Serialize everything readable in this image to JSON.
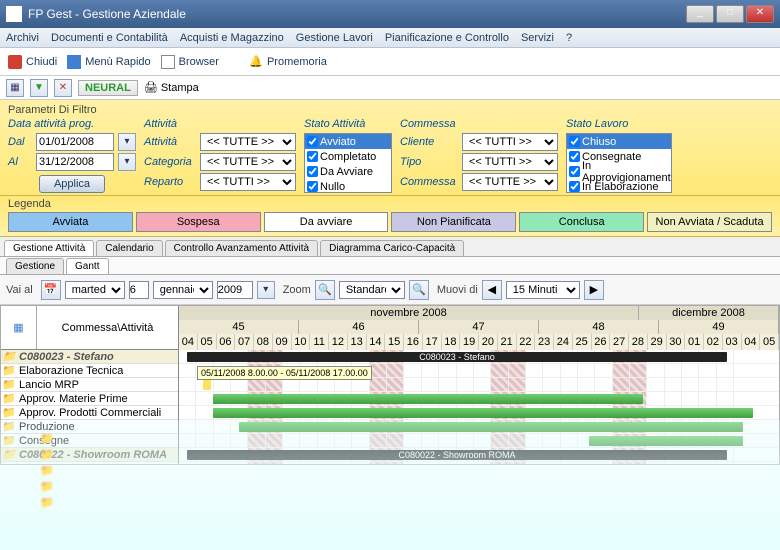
{
  "window": {
    "title": "FP Gest - Gestione Aziendale"
  },
  "menubar": [
    "Archivi",
    "Documenti e Contabilità",
    "Acquisti e Magazzino",
    "Gestione Lavori",
    "Pianificazione e Controllo",
    "Servizi",
    "?"
  ],
  "toolbar1": {
    "chiudi": "Chiudi",
    "menurapido": "Menù Rapido",
    "browser": "Browser",
    "promemoria": "Promemoria"
  },
  "toolbar2": {
    "neural": "NEURAL",
    "stampa": "Stampa"
  },
  "filter": {
    "title": "Parametri Di Filtro",
    "dateheader": "Data attività prog.",
    "dal_lbl": "Dal",
    "dal": "01/01/2008",
    "al_lbl": "Al",
    "al": "31/12/2008",
    "applica": "Applica",
    "attivita_hdr": "Attività",
    "attivita_lbl": "Attività",
    "attivita_val": "<< TUTTE >>",
    "categoria_lbl": "Categoria",
    "categoria_val": "<< TUTTE >>",
    "reparto_lbl": "Reparto",
    "reparto_val": "<< TUTTI >>",
    "stato_hdr": "Stato Attività",
    "stato_items": [
      "Avviato",
      "Completato",
      "Da Avviare",
      "Nullo"
    ],
    "commessa_hdr": "Commessa",
    "cliente_lbl": "Cliente",
    "cliente_val": "<< TUTTI >>",
    "tipo_lbl": "Tipo",
    "tipo_val": "<< TUTTI >>",
    "commessa_lbl": "Commessa",
    "commessa_val": "<< TUTTE >>",
    "statolavoro_hdr": "Stato Lavoro",
    "statolavoro_items": [
      "Chiuso",
      "Consegnate",
      "In Approvigionamento",
      "In Elaborazione"
    ]
  },
  "legend": {
    "title": "Legenda",
    "items": [
      {
        "label": "Avviata",
        "bg": "#8fc4f0"
      },
      {
        "label": "Sospesa",
        "bg": "#f4a8b8"
      },
      {
        "label": "Da avviare",
        "bg": "#ffffff"
      },
      {
        "label": "Non Pianificata",
        "bg": "#c8c8e4"
      },
      {
        "label": "Conclusa",
        "bg": "#90e8b8"
      },
      {
        "label": "Non Avviata / Scaduta",
        "bg": "#f0f0c0"
      }
    ]
  },
  "tabs": [
    "Gestione Attività",
    "Calendario",
    "Controllo Avanzamento Attività",
    "Diagramma Carico-Capacità"
  ],
  "subtabs": [
    "Gestione",
    "Gantt"
  ],
  "gantt": {
    "vaiall": "Vai al",
    "zoom": "Zoom",
    "muovidi": "Muovi di",
    "date_day": "martedì",
    "date_num": "6",
    "date_month": "gennaio",
    "date_year": "2009",
    "zoomval": "Standard",
    "muovival": "15 Minuti",
    "colhdr": "Commessa\\Attività",
    "month1": "novembre 2008",
    "month2": "dicembre 2008",
    "weeks": [
      "45",
      "46",
      "47",
      "48",
      "49"
    ],
    "days": [
      "04",
      "05",
      "06",
      "07",
      "08",
      "09",
      "10",
      "11",
      "12",
      "13",
      "14",
      "15",
      "16",
      "17",
      "18",
      "19",
      "20",
      "21",
      "22",
      "23",
      "24",
      "25",
      "26",
      "27",
      "28",
      "29",
      "30",
      "01",
      "02",
      "03",
      "04",
      "05"
    ],
    "rows": [
      {
        "group": true,
        "label": "C080023 - Stefano"
      },
      {
        "label": "Elaborazione Tecnica"
      },
      {
        "label": "Lancio MRP"
      },
      {
        "label": "Approv. Materie Prime"
      },
      {
        "label": "Approv. Prodotti Commerciali"
      },
      {
        "label": "Produzione"
      },
      {
        "label": "Consegne"
      },
      {
        "group": true,
        "label": "C080022 - Showroom ROMA"
      }
    ],
    "blackbar1": "C080023 - Stefano",
    "blackbar2": "C080022 - Showroom ROMA",
    "tooltip": "05/11/2008 8.00.00 - 05/11/2008 17.00.00"
  }
}
